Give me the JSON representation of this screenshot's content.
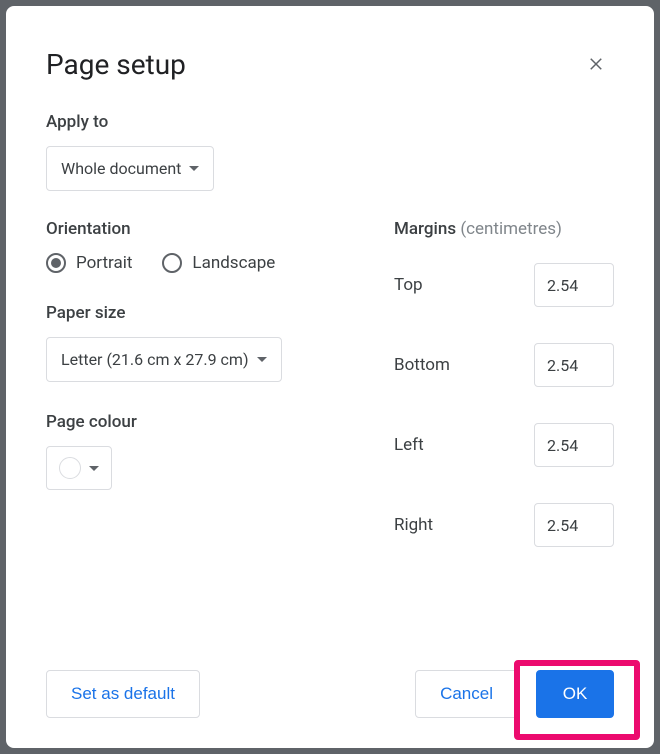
{
  "dialog": {
    "title": "Page setup"
  },
  "apply": {
    "label": "Apply to",
    "value": "Whole document"
  },
  "orientation": {
    "label": "Orientation",
    "portrait": "Portrait",
    "landscape": "Landscape",
    "selected": "portrait"
  },
  "paper": {
    "label": "Paper size",
    "value": "Letter (21.6 cm x 27.9 cm)"
  },
  "colour": {
    "label": "Page colour",
    "value": "#ffffff"
  },
  "margins": {
    "label": "Margins",
    "unit": "(centimetres)",
    "top_label": "Top",
    "top_value": "2.54",
    "bottom_label": "Bottom",
    "bottom_value": "2.54",
    "left_label": "Left",
    "left_value": "2.54",
    "right_label": "Right",
    "right_value": "2.54"
  },
  "buttons": {
    "set_default": "Set as default",
    "cancel": "Cancel",
    "ok": "OK"
  }
}
